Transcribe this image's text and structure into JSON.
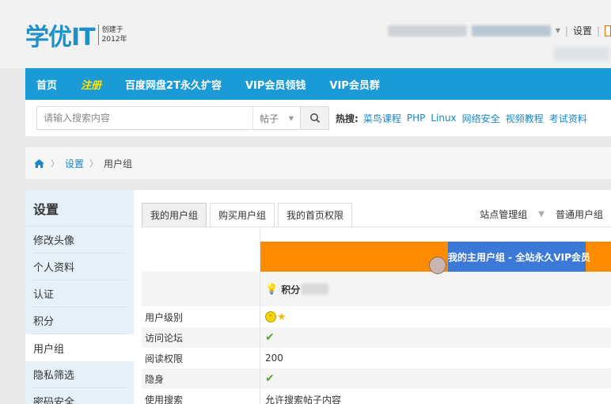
{
  "logo": {
    "main": "学优IT",
    "sub_top": "创建于",
    "sub_bottom": "2012年"
  },
  "user_links": {
    "settings": "设置"
  },
  "nav": {
    "items": [
      {
        "label": "首页"
      },
      {
        "label": "注册"
      },
      {
        "label": "百度网盘2T永久扩容"
      },
      {
        "label": "VIP会员领钱"
      },
      {
        "label": "VIP会员群"
      }
    ]
  },
  "search": {
    "placeholder": "请输入搜索内容",
    "type_selected": "帖子",
    "hot_label": "热搜:",
    "hot_words": [
      "菜鸟课程",
      "PHP",
      "Linux",
      "网络安全",
      "视频教程",
      "考试资料"
    ]
  },
  "breadcrumb": {
    "items": [
      "设置",
      "用户组"
    ]
  },
  "sidebar": {
    "title": "设置",
    "items": [
      "修改头像",
      "个人资料",
      "认证",
      "积分",
      "用户组",
      "隐私筛选",
      "密码安全"
    ],
    "active_index": 4
  },
  "tabs": {
    "items": [
      "我的用户组",
      "购买用户组",
      "我的首页权限"
    ],
    "right": [
      "站点管理组",
      "普通用户组"
    ]
  },
  "group_table": {
    "banner_text": "我的主用户组 - 全站永久VIP会员",
    "points_label": "积分",
    "rows": [
      {
        "label": "用户级别",
        "value": ""
      },
      {
        "label": "访问论坛",
        "value": "✔"
      },
      {
        "label": "阅读权限",
        "value": "200"
      },
      {
        "label": "隐身",
        "value": "✔"
      },
      {
        "label": "使用搜索",
        "value": "允许搜索帖子内容"
      }
    ]
  },
  "colors": {
    "nav_bg": "#1a9bd6",
    "banner_orange": "#ff8c00",
    "banner_blue": "#3b78d8",
    "link": "#1a87c9",
    "hot_nav": "#ffe400"
  }
}
